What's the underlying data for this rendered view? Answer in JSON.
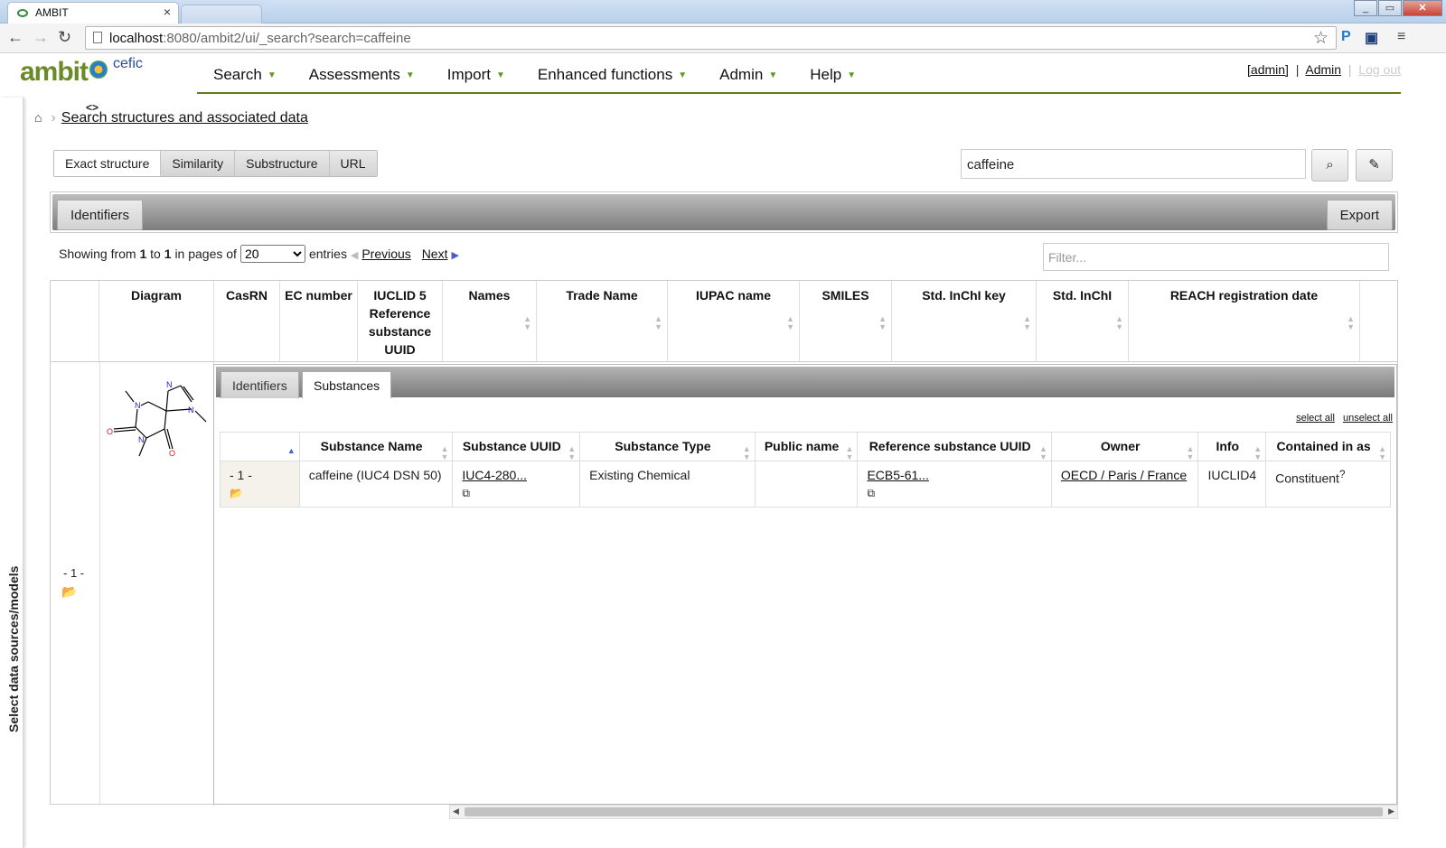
{
  "browser": {
    "tab_title": "AMBIT",
    "tab_close": "×",
    "url_host": "localhost",
    "url_path": ":8080/ambit2/ui/_search?search=caffeine",
    "window_buttons": [
      "_",
      "▭",
      "✕"
    ]
  },
  "app": {
    "logo_text": "ambit",
    "logo_partner": "cefic",
    "nav": [
      {
        "label": "Search"
      },
      {
        "label": "Assessments"
      },
      {
        "label": "Import"
      },
      {
        "label": "Enhanced functions"
      },
      {
        "label": "Admin"
      },
      {
        "label": "Help"
      }
    ],
    "user": {
      "bracket_user": "[admin]",
      "admin_link": "Admin",
      "logout": "Log out"
    }
  },
  "sidebar": {
    "label": "Select data sources/models"
  },
  "breadcrumb": {
    "home_icon": "home-icon",
    "current": "Search structures and associated data"
  },
  "search": {
    "types": [
      "Exact structure",
      "Similarity",
      "Substructure",
      "URL"
    ],
    "active_type": "Exact structure",
    "query": "caffeine",
    "search_icon": "search-icon",
    "draw_icon": "pencil-icon"
  },
  "panel": {
    "left_button": "Identifiers",
    "right_button": "Export"
  },
  "pager": {
    "showing_prefix": "Showing from",
    "from": "1",
    "to_word": "to",
    "to": "1",
    "pages_of": "in pages of",
    "page_size": "20",
    "entries": "entries",
    "previous": "Previous",
    "next": "Next",
    "filter_placeholder": "Filter..."
  },
  "main_headers": [
    "",
    "Diagram",
    "CasRN",
    "EC number",
    "IUCLID 5 Reference substance UUID",
    "Names",
    "Trade Name",
    "IUPAC name",
    "SMILES",
    "Std. InChI key",
    "Std. InChI",
    "REACH registration date"
  ],
  "row": {
    "index": "- 1 -",
    "folder_icon": "folder-open-icon",
    "nested_tabs": [
      "Identifiers",
      "Substances"
    ],
    "active_nested_tab": "Substances",
    "select_all": "select all",
    "unselect_all": "unselect all",
    "substance_headers": [
      "",
      "Substance Name",
      "Substance UUID",
      "Substance Type",
      "Public name",
      "Reference substance UUID",
      "Owner",
      "Info",
      "Contained in as"
    ],
    "substances": [
      {
        "index": "- 1 -",
        "name": "caffeine (IUC4 DSN 50)",
        "uuid": "IUC4-280...",
        "type": "Existing Chemical",
        "public_name": "",
        "ref_uuid": "ECB5-61...",
        "owner": "OECD / Paris / France",
        "info": "IUCLID4",
        "contained": "Constituent",
        "contained_sup": "?"
      }
    ]
  },
  "colors": {
    "accent_green": "#5a7f1c",
    "sort_active": "#4a5ad0",
    "panel_dark": "#7d7d7d"
  }
}
